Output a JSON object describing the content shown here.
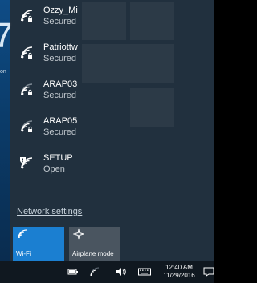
{
  "desktop": {
    "big_glyph": "7",
    "edge_label": "on"
  },
  "networks": [
    {
      "name": "Ozzy_Mi",
      "status": "Secured",
      "icon": "wifi-secured-icon",
      "strength": "full"
    },
    {
      "name": "Patriottw",
      "status": "Secured",
      "icon": "wifi-secured-icon",
      "strength": "full"
    },
    {
      "name": "ARAP03",
      "status": "Secured",
      "icon": "wifi-secured-icon",
      "strength": "partial"
    },
    {
      "name": "ARAP05",
      "status": "Secured",
      "icon": "wifi-secured-icon",
      "strength": "partial"
    },
    {
      "name": "SETUP",
      "status": "Open",
      "icon": "wifi-open-shield-icon",
      "strength": "full"
    }
  ],
  "network_settings_label": "Network settings",
  "quick_actions": {
    "wifi": {
      "label": "Wi-Fi",
      "icon": "wifi-icon",
      "active": true
    },
    "airplane": {
      "label": "Airplane mode",
      "icon": "airplane-icon",
      "active": false
    }
  },
  "taskbar": {
    "time": "12:40 AM",
    "date": "11/29/2016",
    "icons": [
      "battery-icon",
      "network-icon",
      "volume-icon",
      "keyboard-icon",
      "action-center-icon"
    ]
  },
  "colors": {
    "accent": "#1b7fd1",
    "flyout_bg": "#22303c",
    "taskbar_bg": "#101820"
  }
}
